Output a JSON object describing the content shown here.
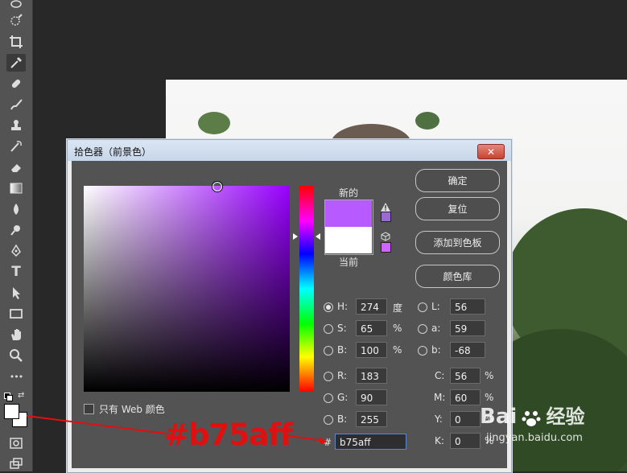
{
  "dialog": {
    "title": "拾色器（前景色）",
    "close_symbol": "✕",
    "label_new": "新的",
    "label_current": "当前",
    "buttons": {
      "ok": "确定",
      "reset": "复位",
      "add_to_swatches": "添加到色板",
      "color_libraries": "颜色库"
    },
    "only_web_colors": "只有 Web 颜色",
    "new_color": "#b75aff",
    "current_color": "#ffffff",
    "hsb": {
      "h": {
        "label": "H:",
        "value": "274",
        "unit": "度"
      },
      "s": {
        "label": "S:",
        "value": "65",
        "unit": "%"
      },
      "b": {
        "label": "B:",
        "value": "100",
        "unit": "%"
      }
    },
    "lab": {
      "l": {
        "label": "L:",
        "value": "56"
      },
      "a": {
        "label": "a:",
        "value": "59"
      },
      "b": {
        "label": "b:",
        "value": "-68"
      }
    },
    "rgb": {
      "r": {
        "label": "R:",
        "value": "183"
      },
      "g": {
        "label": "G:",
        "value": "90"
      },
      "b": {
        "label": "B:",
        "value": "255"
      }
    },
    "cmyk": {
      "c": {
        "label": "C:",
        "value": "56",
        "unit": "%"
      },
      "m": {
        "label": "M:",
        "value": "60",
        "unit": "%"
      },
      "y": {
        "label": "Y:",
        "value": "0",
        "unit": "%"
      },
      "k": {
        "label": "K:",
        "value": "0",
        "unit": "%"
      }
    },
    "hex": {
      "label": "#",
      "value": "b75aff"
    }
  },
  "annotation": {
    "text": "#b75aff"
  },
  "watermark": {
    "brand_a": "Bai",
    "brand_b": "经验",
    "url": "jingyan.baidu.com"
  },
  "toolbar": {
    "tools": [
      "lasso-icon",
      "quick-select-icon",
      "crop-icon",
      "eyedropper-icon",
      "healing-icon",
      "brush-icon",
      "stamp-icon",
      "history-brush-icon",
      "eraser-icon",
      "gradient-icon",
      "blur-icon",
      "dodge-icon",
      "pen-icon",
      "type-icon",
      "path-select-icon",
      "rectangle-icon",
      "hand-icon",
      "zoom-icon",
      "more-icon"
    ],
    "type_glyph": "T",
    "more_glyph": "•••"
  }
}
